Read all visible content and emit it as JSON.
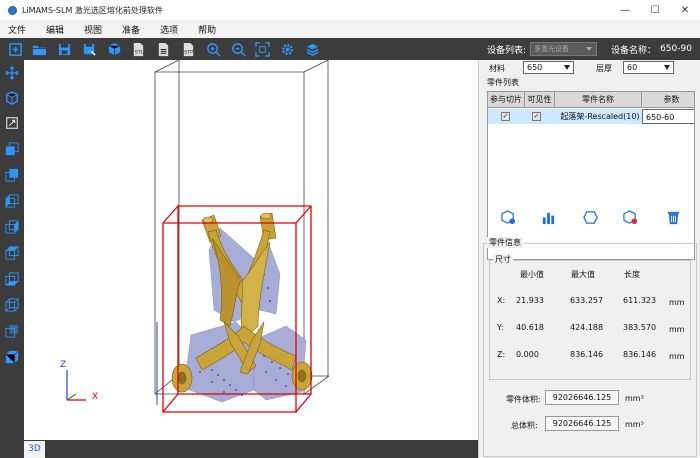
{
  "window": {
    "title": "LiMAMS-SLM 激光选区熔化前处理软件",
    "minimize": "—",
    "maximize": "☐",
    "close": "✕"
  },
  "menu": [
    "文件",
    "编辑",
    "视图",
    "准备",
    "选项",
    "帮助"
  ],
  "toolbar": {
    "icons": [
      "new-file-icon",
      "open-folder-icon",
      "save-icon",
      "save-as-icon",
      "import-cube-icon",
      "export-stl-icon",
      "export-slice-icon",
      "export-stp-icon",
      "zoom-in-icon",
      "zoom-out-icon",
      "fit-view-icon",
      "settings-gear-icon",
      "layers-icon"
    ],
    "device_list_label": "设备列表:",
    "device_list_value": "多激光设备",
    "device_name_label": "设备名称：",
    "device_name_value": "650-90",
    "accent": "#2f95ff"
  },
  "left_tools": [
    "move-axes-icon",
    "cube-view-icon",
    "scale-icon",
    "view-front-icon",
    "view-back-icon",
    "view-left-icon",
    "view-right-icon",
    "view-top-icon",
    "view-bottom-icon",
    "view-iso-icon",
    "view-iso2-icon",
    "solid-cube-icon"
  ],
  "viewport": {
    "tab_label": "3D",
    "axis_z": "Z",
    "axis_x": "X"
  },
  "panel": {
    "material_label": "材料",
    "material_value": "650",
    "layer_label": "层厚",
    "layer_value": "60",
    "part_list_title": "零件列表",
    "columns": [
      "参与切片",
      "可见性",
      "零件名称",
      "参数"
    ],
    "parts": [
      {
        "slice": true,
        "visible": true,
        "name": "起落架-Rescaled(10)",
        "param": "650-60"
      }
    ],
    "part_actions": [
      "add-part-icon",
      "chart-icon",
      "hexagon-icon",
      "remove-part-icon",
      "trash-icon"
    ],
    "part_info_title": "零件信息",
    "size_title": "尺寸",
    "size_headers": [
      "最小值",
      "最大值",
      "长度"
    ],
    "rows": [
      {
        "axis": "X:",
        "min": "21.933",
        "max": "633.257",
        "len": "611.323",
        "unit": "mm"
      },
      {
        "axis": "Y:",
        "min": "40.618",
        "max": "424.188",
        "len": "383.570",
        "unit": "mm"
      },
      {
        "axis": "Z:",
        "min": "0.000",
        "max": "836.146",
        "len": "836.146",
        "unit": "mm"
      }
    ],
    "volume_label": "零件体积:",
    "volume_value": "92026646.125",
    "volume_unit": "mm³",
    "total_volume_label": "总体积:",
    "total_volume_value": "92026646.125",
    "total_volume_unit": "mm³"
  }
}
